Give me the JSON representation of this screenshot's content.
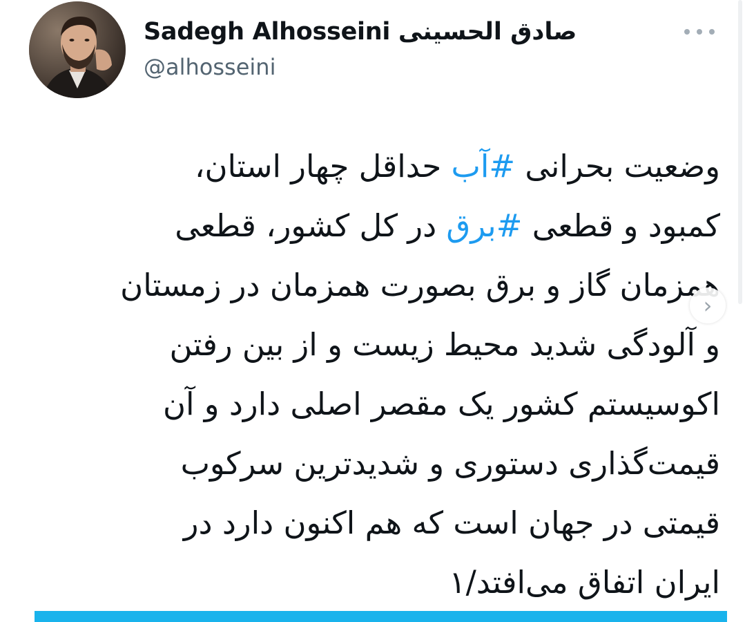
{
  "author": {
    "display_name": "Sadegh Alhosseini صادق الحسینی",
    "handle": "@alhosseini",
    "avatar_icon": "profile-photo"
  },
  "menu": {
    "more_icon": "more-dots-icon"
  },
  "tweet": {
    "lines": [
      [
        {
          "text": "وضعیت بحرانی ",
          "hashtag": false
        },
        {
          "text": "#آب",
          "hashtag": true
        },
        {
          "text": " حداقل چهار استان،",
          "hashtag": false
        }
      ],
      [
        {
          "text": "کمبود و قطعی ",
          "hashtag": false
        },
        {
          "text": "#برق",
          "hashtag": true
        },
        {
          "text": " در کل کشور، قطعی",
          "hashtag": false
        }
      ],
      [
        {
          "text": "همزمان گاز و برق بصورت همزمان در زمستان",
          "hashtag": false
        }
      ],
      [
        {
          "text": "و آلودگی شدید محیط زیست و از بین رفتن",
          "hashtag": false
        }
      ],
      [
        {
          "text": "اکوسیستم کشور یک مقصر اصلی دارد و آن",
          "hashtag": false
        }
      ],
      [
        {
          "text": "قیمت‌گذاری دستوری و شدیدترین سرکوب",
          "hashtag": false
        }
      ],
      [
        {
          "text": "قیمتی در جهان است که هم اکنون دارد در",
          "hashtag": false
        }
      ],
      [
        {
          "text": "ایران اتفاق می‌افتد/۱",
          "hashtag": false
        }
      ]
    ]
  },
  "navigation": {
    "next_arrow": "›"
  },
  "colors": {
    "text": "#0f1419",
    "secondary": "#536471",
    "hashtag": "#1d9bf0",
    "bottom_bar": "#19b3ec"
  }
}
